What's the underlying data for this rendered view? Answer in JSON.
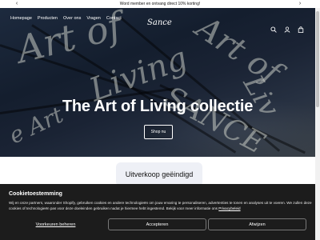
{
  "announcement": {
    "text": "Word member en ontvang direct 10% korting!",
    "prev_icon": "chevron-left-icon",
    "next_icon": "chevron-right-icon"
  },
  "header": {
    "logo": "Sance",
    "nav": [
      "Homepage",
      "Producten",
      "Over ons",
      "Vragen",
      "Contact"
    ],
    "icons": [
      "search-icon",
      "account-icon",
      "cart-icon"
    ]
  },
  "hero": {
    "title": "The Art of Living collectie",
    "button": "Shop nu"
  },
  "soldout": {
    "label": "Uitverkoop geëindigd"
  },
  "cookie": {
    "title": "Cookietoestemming",
    "text": "Wij en onze partners, waaronder Shopify, gebruiken cookies en andere technologieën om jouw ervaring te personaliseren, advertenties te tonen en analyses uit te voeren. We zullen deze cookies of technologieën pas voor deze doeleinden gebruiken nadat je hiermee hebt ingestemd. Bekijk voor meer informatie ons",
    "link": "Privacybeleid",
    "manage": "Voorkeuren beheren",
    "accept": "Accepteren",
    "reject": "Afwijzen"
  },
  "colors": {
    "hero_dark": "#141e2e",
    "cookie_bg": "#1c1c1c",
    "soldout_bg": "#eef0f6"
  }
}
